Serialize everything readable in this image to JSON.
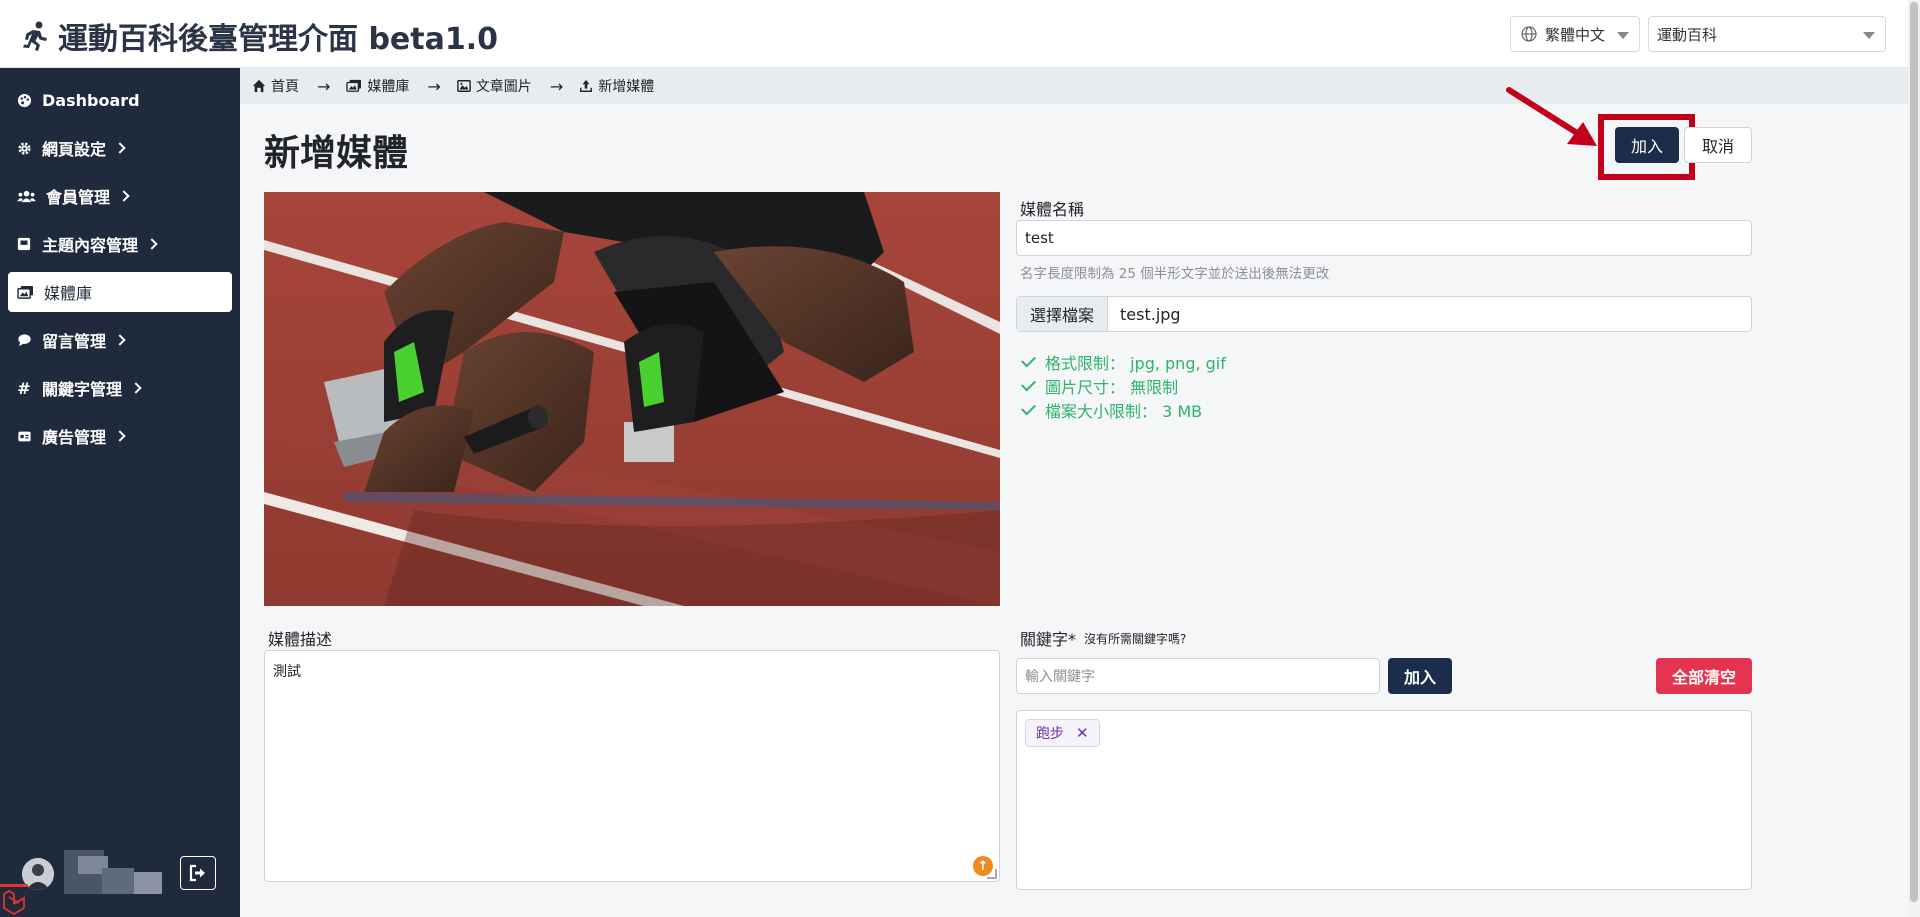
{
  "header": {
    "title": "運動百科後臺管理介面 beta1.0",
    "language": "繁體中文",
    "site": "運動百科"
  },
  "sidebar": {
    "items": [
      {
        "label": "Dashboard",
        "icon": "palette-icon",
        "has_submenu": false,
        "active": false
      },
      {
        "label": "網頁設定",
        "icon": "gear-icon",
        "has_submenu": true,
        "active": false
      },
      {
        "label": "會員管理",
        "icon": "users-icon",
        "has_submenu": true,
        "active": false
      },
      {
        "label": "主題內容管理",
        "icon": "book-icon",
        "has_submenu": true,
        "active": false
      },
      {
        "label": "媒體庫",
        "icon": "images-icon",
        "has_submenu": false,
        "active": true
      },
      {
        "label": "留言管理",
        "icon": "comment-icon",
        "has_submenu": true,
        "active": false
      },
      {
        "label": "關鍵字管理",
        "icon": "hashtag-icon",
        "has_submenu": true,
        "active": false
      },
      {
        "label": "廣告管理",
        "icon": "ad-icon",
        "has_submenu": true,
        "active": false
      }
    ]
  },
  "breadcrumb": [
    {
      "label": "首頁",
      "icon": "home-icon"
    },
    {
      "label": "媒體庫",
      "icon": "images-icon"
    },
    {
      "label": "文章圖片",
      "icon": "image-icon"
    },
    {
      "label": "新增媒體",
      "icon": "upload-icon"
    }
  ],
  "page": {
    "title": "新增媒體",
    "add_button": "加入",
    "cancel_button": "取消"
  },
  "form": {
    "name_label": "媒體名稱",
    "name_value": "test",
    "name_hint": "名字長度限制為 25 個半形文字並於送出後無法更改",
    "file_button": "選擇檔案",
    "file_name": "test.jpg",
    "rules": [
      "格式限制： jpg, png, gif",
      "圖片尺寸： 無限制",
      "檔案大小限制： 3 MB"
    ],
    "description_label": "媒體描述",
    "description_value": "測試",
    "keyword_label": "關鍵字*",
    "keyword_note": "沒有所需關鍵字嗎?",
    "keyword_placeholder": "輸入關鍵字",
    "keyword_add_button": "加入",
    "clear_all_button": "全部清空",
    "tags": [
      "跑步"
    ]
  },
  "colors": {
    "sidebar_bg": "#1f2a3c",
    "primary": "#1b2d4b",
    "danger": "#e4344f",
    "success": "#2fb36a",
    "annotation": "#c3001a",
    "tag_text": "#6d2fa5"
  }
}
